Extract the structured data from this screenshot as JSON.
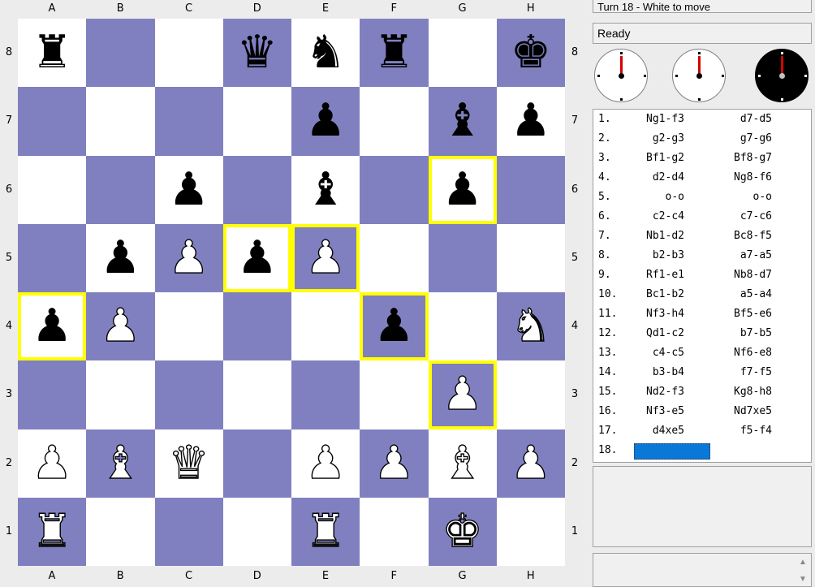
{
  "files": [
    "A",
    "B",
    "C",
    "D",
    "E",
    "F",
    "G",
    "H"
  ],
  "ranks": [
    "8",
    "7",
    "6",
    "5",
    "4",
    "3",
    "2",
    "1"
  ],
  "board": [
    [
      "br",
      "",
      "",
      "bq",
      "bn",
      "br",
      "",
      "bk"
    ],
    [
      "",
      "",
      "",
      "",
      "bp",
      "",
      "bb",
      "bp"
    ],
    [
      "",
      "",
      "bp",
      "",
      "bb",
      "",
      "bp",
      ""
    ],
    [
      "",
      "bp",
      "wp",
      "bp",
      "wp",
      "",
      "",
      ""
    ],
    [
      "bp",
      "wp",
      "",
      "",
      "",
      "bp",
      "",
      "wn"
    ],
    [
      "",
      "",
      "",
      "",
      "",
      "",
      "wp",
      ""
    ],
    [
      "wp",
      "wb",
      "wq",
      "",
      "wp",
      "wp",
      "wb",
      "wp"
    ],
    [
      "wr",
      "",
      "",
      "",
      "wr",
      "",
      "wk",
      ""
    ]
  ],
  "highlighted": [
    "g6",
    "d5",
    "e5",
    "a4",
    "f4",
    "g3"
  ],
  "turn_label": "Turn 18 - White to move",
  "status": "Ready",
  "moves": [
    {
      "num": "1.",
      "white": "Ng1-f3",
      "black": "d7-d5"
    },
    {
      "num": "2.",
      "white": "g2-g3",
      "black": "g7-g6"
    },
    {
      "num": "3.",
      "white": "Bf1-g2",
      "black": "Bf8-g7"
    },
    {
      "num": "4.",
      "white": "d2-d4",
      "black": "Ng8-f6"
    },
    {
      "num": "5.",
      "white": "o-o",
      "black": "o-o"
    },
    {
      "num": "6.",
      "white": "c2-c4",
      "black": "c7-c6"
    },
    {
      "num": "7.",
      "white": "Nb1-d2",
      "black": "Bc8-f5"
    },
    {
      "num": "8.",
      "white": "b2-b3",
      "black": "a7-a5"
    },
    {
      "num": "9.",
      "white": "Rf1-e1",
      "black": "Nb8-d7"
    },
    {
      "num": "10.",
      "white": "Bc1-b2",
      "black": "a5-a4"
    },
    {
      "num": "11.",
      "white": "Nf3-h4",
      "black": "Bf5-e6"
    },
    {
      "num": "12.",
      "white": "Qd1-c2",
      "black": "b7-b5"
    },
    {
      "num": "13.",
      "white": "c4-c5",
      "black": "Nf6-e8"
    },
    {
      "num": "14.",
      "white": "b3-b4",
      "black": "f7-f5"
    },
    {
      "num": "15.",
      "white": "Nd2-f3",
      "black": "Kg8-h8"
    },
    {
      "num": "16.",
      "white": "Nf3-e5",
      "black": "Nd7xe5"
    },
    {
      "num": "17.",
      "white": "d4xe5",
      "black": "f5-f4"
    },
    {
      "num": "18.",
      "white": "",
      "black": ""
    }
  ],
  "colors": {
    "light": "#ffffff",
    "dark": "#8080c0",
    "highlight": "#ffff00",
    "clock_hand": "#d80000",
    "current_move": "#0a78d7"
  }
}
